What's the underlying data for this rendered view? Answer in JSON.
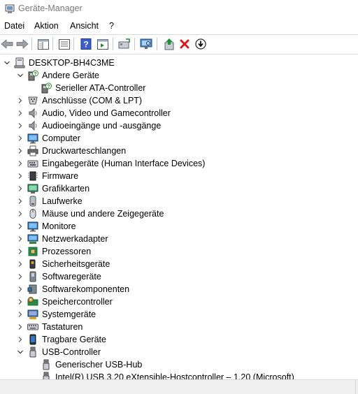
{
  "window": {
    "title": "Geräte-Manager"
  },
  "menu": [
    "Datei",
    "Aktion",
    "Ansicht",
    "?"
  ],
  "toolbar": [
    {
      "name": "back-button",
      "icon": "arrow-left-icon"
    },
    {
      "name": "forward-button",
      "icon": "arrow-right-icon"
    },
    {
      "name": "show-hide-console-tree-button",
      "icon": "console-tree-icon"
    },
    {
      "name": "properties-button",
      "icon": "properties-icon"
    },
    {
      "name": "help-button",
      "icon": "help-icon"
    },
    {
      "name": "action-pane-button",
      "icon": "action-pane-icon"
    },
    {
      "name": "update-driver-button",
      "icon": "update-driver-icon"
    },
    {
      "name": "scan-hardware-button",
      "icon": "scan-monitor-icon"
    },
    {
      "name": "add-legacy-hardware-button",
      "icon": "add-hardware-icon"
    },
    {
      "name": "uninstall-device-button",
      "icon": "uninstall-x-icon"
    },
    {
      "name": "disable-device-button",
      "icon": "disable-device-icon"
    }
  ],
  "tree": {
    "root": {
      "label": "DESKTOP-BH4C3ME",
      "icon": "computer-icon",
      "expanded": true
    },
    "nodes": [
      {
        "label": "Andere Geräte",
        "icon": "unknown-device-icon",
        "level": 1,
        "expanded": true
      },
      {
        "label": "Serieller ATA-Controller",
        "icon": "unknown-device-icon",
        "level": 2
      },
      {
        "label": "Anschlüsse (COM & LPT)",
        "icon": "port-icon",
        "level": 1
      },
      {
        "label": "Audio, Video und Gamecontroller",
        "icon": "speaker-icon",
        "level": 1
      },
      {
        "label": "Audioeingänge und -ausgänge",
        "icon": "speaker-icon",
        "level": 1
      },
      {
        "label": "Computer",
        "icon": "monitor-icon",
        "level": 1
      },
      {
        "label": "Druckwarteschlangen",
        "icon": "printer-icon",
        "level": 1
      },
      {
        "label": "Eingabegeräte (Human Interface Devices)",
        "icon": "hid-icon",
        "level": 1
      },
      {
        "label": "Firmware",
        "icon": "chip-icon",
        "level": 1
      },
      {
        "label": "Grafikkarten",
        "icon": "display-adapter-icon",
        "level": 1
      },
      {
        "label": "Laufwerke",
        "icon": "disk-drive-icon",
        "level": 1
      },
      {
        "label": "Mäuse und andere Zeigegeräte",
        "icon": "mouse-icon",
        "level": 1
      },
      {
        "label": "Monitore",
        "icon": "monitor-icon",
        "level": 1
      },
      {
        "label": "Netzwerkadapter",
        "icon": "network-adapter-icon",
        "level": 1
      },
      {
        "label": "Prozessoren",
        "icon": "processor-icon",
        "level": 1
      },
      {
        "label": "Sicherheitsgeräte",
        "icon": "security-key-icon",
        "level": 1
      },
      {
        "label": "Softwaregeräte",
        "icon": "software-device-icon",
        "level": 1
      },
      {
        "label": "Softwarekomponenten",
        "icon": "software-component-icon",
        "level": 1
      },
      {
        "label": "Speichercontroller",
        "icon": "storage-controller-icon",
        "level": 1
      },
      {
        "label": "Systemgeräte",
        "icon": "system-device-icon",
        "level": 1
      },
      {
        "label": "Tastaturen",
        "icon": "keyboard-icon",
        "level": 1
      },
      {
        "label": "Tragbare Geräte",
        "icon": "portable-device-icon",
        "level": 1
      },
      {
        "label": "USB-Controller",
        "icon": "usb-icon",
        "level": 1,
        "expanded": true
      },
      {
        "label": "Generischer USB-Hub",
        "icon": "usb-icon",
        "level": 2
      },
      {
        "label": "Intel(R) USB 3.20 eXtensible-Hostcontroller – 1.20 (Microsoft)",
        "icon": "usb-icon",
        "level": 2
      }
    ]
  },
  "colors": {
    "title_text": "#7a7a7a",
    "help_button": "#3a5fcd",
    "uninstall": "#d7191c",
    "update": "#1f8f3a"
  }
}
